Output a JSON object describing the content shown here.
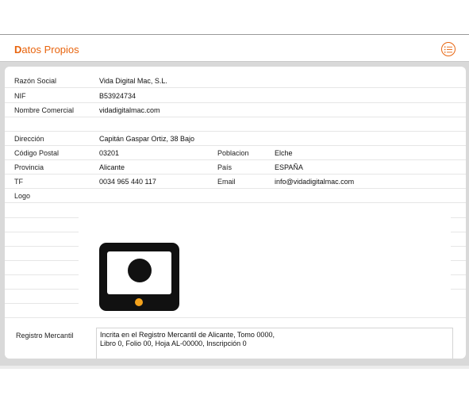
{
  "header": {
    "title_cap": "D",
    "title_rest": "atos Propios",
    "menu_icon": "list-icon",
    "accent_color": "#e8650f"
  },
  "fields": {
    "razon_social": {
      "label": "Razón Social",
      "value": "Vida Digital Mac, S.L."
    },
    "nif": {
      "label": "NIF",
      "value": "B53924734"
    },
    "nombre_comercial": {
      "label": "Nombre Comercial",
      "value": "vidadigitalmac.com"
    },
    "direccion": {
      "label": "Dirección",
      "value": "Capitán Gaspar Ortiz, 38 Bajo"
    },
    "codigo_postal": {
      "label": "Código Postal",
      "value": "03201"
    },
    "poblacion": {
      "label": "Poblacion",
      "value": "Elche"
    },
    "provincia": {
      "label": "Provincia",
      "value": "Alicante"
    },
    "pais": {
      "label": "País",
      "value": "ESPAÑA"
    },
    "tf": {
      "label": "TF",
      "value": "0034 965 440 117"
    },
    "email": {
      "label": "Email",
      "value": "info@vidadigitalmac.com"
    },
    "logo": {
      "label": "Logo",
      "icon": "tablet-camera-logo"
    },
    "registro_mercantil": {
      "label": "Registro Mercantil",
      "value": "Incrita en el Registro Mercantil de Alicante, Tomo 0000,\nLibro 0, Folio 00, Hoja AL-00000, Inscripción 0"
    }
  }
}
